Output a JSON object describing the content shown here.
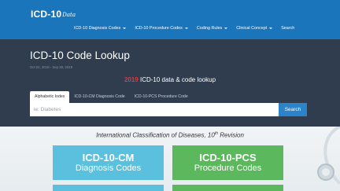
{
  "brand": {
    "name": "ICD-10",
    "script": "Data"
  },
  "nav": [
    {
      "label": "ICD-10 Diagnosis Codes",
      "dropdown": true
    },
    {
      "label": "ICD-10 Procedure Codes",
      "dropdown": true
    },
    {
      "label": "Coding Rules",
      "dropdown": true
    },
    {
      "label": "Clinical Concept",
      "dropdown": true
    },
    {
      "label": "Search",
      "dropdown": false
    }
  ],
  "hero": {
    "title": "ICD-10 Code Lookup",
    "dates": "Oct 01, 2018 - Sep 30, 2019",
    "year": "2019",
    "subtitle": " ICD-10 data & code lookup"
  },
  "tabs": [
    {
      "label": "Alphabetic Index",
      "active": true
    },
    {
      "label": "ICD-10-CM Diagnosis Code",
      "active": false
    },
    {
      "label": "ICD-10-PCS Procedure Code",
      "active": false
    }
  ],
  "search": {
    "placeholder": "ie: Diabetes",
    "value": "",
    "button": "Search"
  },
  "tagline": {
    "text": "International Classification of Diseases, 10",
    "sup": "th",
    "tail": " Revision"
  },
  "cards": [
    {
      "title": "ICD-10-CM",
      "subtitle": "Diagnosis Codes",
      "color": "#5bc0de"
    },
    {
      "title": "ICD-10-PCS",
      "subtitle": "Procedure Codes",
      "color": "#5cb85c"
    }
  ],
  "colors": {
    "navbar": "#1b75bb",
    "hero": "#2f3d4f",
    "year": "#e2353b",
    "search_button": "#2b83c9"
  }
}
